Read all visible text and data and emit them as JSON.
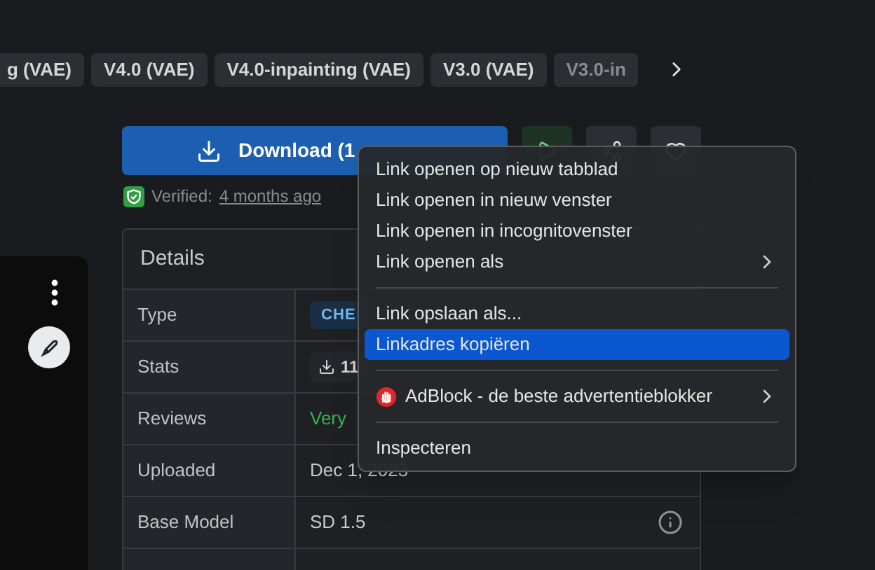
{
  "version_tabs": [
    {
      "label": "g (VAE)"
    },
    {
      "label": "V4.0 (VAE)"
    },
    {
      "label": "V4.0-inpainting (VAE)"
    },
    {
      "label": "V3.0 (VAE)"
    },
    {
      "label": "V3.0-in"
    }
  ],
  "download": {
    "label": "Download (1"
  },
  "verified": {
    "label": "Verified:",
    "time": "4 months ago"
  },
  "details": {
    "title": "Details",
    "rows": [
      {
        "label": "Type",
        "value": "CHE",
        "kind": "badge"
      },
      {
        "label": "Stats",
        "value": "11",
        "kind": "stat"
      },
      {
        "label": "Reviews",
        "value": "Very",
        "kind": "review"
      },
      {
        "label": "Uploaded",
        "value": "Dec 1, 2023",
        "kind": "text"
      },
      {
        "label": "Base Model",
        "value": "SD 1.5",
        "kind": "info"
      }
    ]
  },
  "context_menu": {
    "items": [
      {
        "kind": "item",
        "label": "Link openen op nieuw tabblad",
        "submenu": false,
        "selected": false
      },
      {
        "kind": "item",
        "label": "Link openen in nieuw venster",
        "submenu": false,
        "selected": false
      },
      {
        "kind": "item",
        "label": "Link openen in incognitovenster",
        "submenu": false,
        "selected": false
      },
      {
        "kind": "item",
        "label": "Link openen als",
        "submenu": true,
        "selected": false
      },
      {
        "kind": "separator"
      },
      {
        "kind": "item",
        "label": "Link opslaan als...",
        "submenu": false,
        "selected": false
      },
      {
        "kind": "item",
        "label": "Linkadres kopiëren",
        "submenu": false,
        "selected": true
      },
      {
        "kind": "separator"
      },
      {
        "kind": "extension",
        "label": "AdBlock - de beste advertentieblokker",
        "submenu": true,
        "selected": false
      },
      {
        "kind": "separator"
      },
      {
        "kind": "item",
        "label": "Inspecteren",
        "submenu": false,
        "selected": false
      }
    ]
  }
}
